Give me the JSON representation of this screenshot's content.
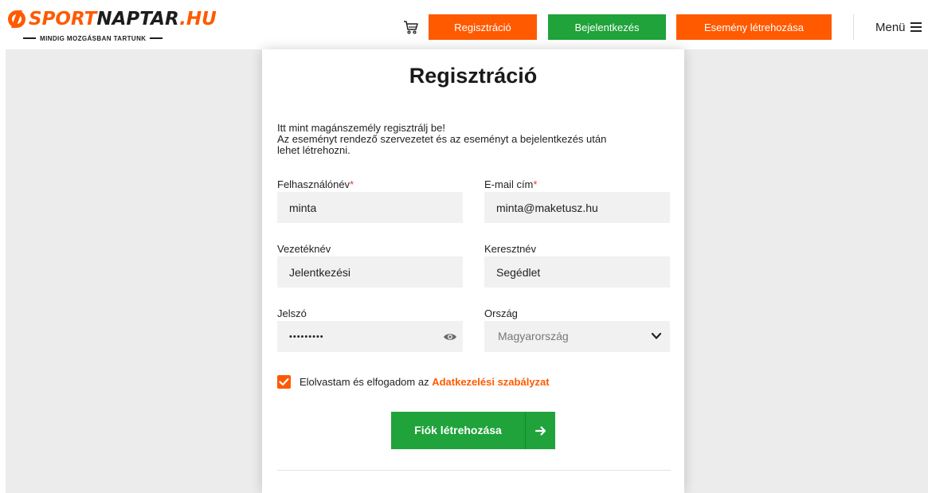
{
  "header": {
    "logo": {
      "sport": "SPORT",
      "naptar": "NAPTAR",
      "hu": ".HU",
      "tagline": "MINDIG MOZGÁSBAN TARTUNK"
    },
    "buttons": {
      "register": "Regisztráció",
      "login": "Bejelentkezés",
      "create_event": "Esemény létrehozása"
    },
    "menu_label": "Menü",
    "icons": {
      "cart": "cart-icon",
      "menu": "hamburger-icon"
    }
  },
  "form": {
    "title": "Regisztráció",
    "intro": [
      "Itt mint magánszemély regisztrálj be!",
      "Az eseményt rendező szervezetet és az eseményt a bejelentkezés után",
      "lehet létrehozni."
    ],
    "username": {
      "label": "Felhasználónév",
      "required": "*",
      "value": "minta"
    },
    "email": {
      "label": "E-mail cím",
      "required": "*",
      "value": "minta@maketusz.hu"
    },
    "lastname": {
      "label": "Vezetéknév",
      "value": "Jelentkezési"
    },
    "firstname": {
      "label": "Keresztnév",
      "value": "Segédlet"
    },
    "password": {
      "label": "Jelszó",
      "value": "•••••••••"
    },
    "country": {
      "label": "Ország",
      "value": "Magyarország"
    },
    "consent": {
      "checked": true,
      "text": "Elolvastam és elfogadom az ",
      "link": "Adatkezelési szabályzat"
    },
    "submit_label": "Fiók létrehozása"
  },
  "colors": {
    "orange": "#ff5a00",
    "green": "#1fa33a",
    "page_bg": "#ececec",
    "field_bg": "#f1f1f1"
  }
}
